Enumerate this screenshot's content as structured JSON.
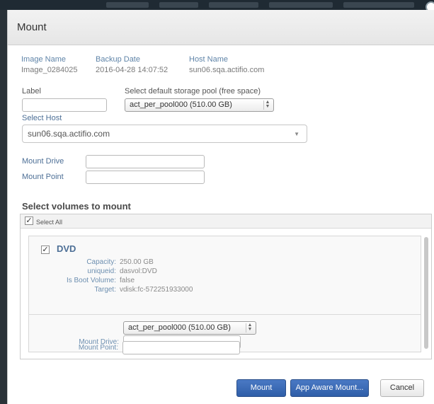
{
  "dialog": {
    "title": "Mount"
  },
  "image_info": {
    "image_name_label": "Image Name",
    "image_name_value": "Image_0284025",
    "backup_date_label": "Backup Date",
    "backup_date_value": "2016-04-28 14:07:52",
    "host_name_label": "Host Name",
    "host_name_value": "sun06.sqa.actifio.com"
  },
  "label_field": {
    "label": "Label",
    "value": ""
  },
  "storage_pool": {
    "label": "Select default storage pool (free space)",
    "value": "act_per_pool000 (510.00 GB)"
  },
  "host": {
    "label": "Select Host",
    "value": "sun06.sqa.actifio.com"
  },
  "mount_drive": {
    "label": "Mount Drive",
    "value": ""
  },
  "mount_point": {
    "label": "Mount Point",
    "value": ""
  },
  "volumes": {
    "title": "Select volumes to mount",
    "select_all_label": "Select All",
    "select_all_checked": true,
    "items": [
      {
        "name": "DVD",
        "checked": true,
        "capacity_label": "Capacity:",
        "capacity_value": "250.00 GB",
        "uniqueid_label": "uniqueid:",
        "uniqueid_value": "dasvol:DVD",
        "boot_label": "Is Boot Volume:",
        "boot_value": "false",
        "target_label": "Target:",
        "target_value": "vdisk:fc-572251933000",
        "pool_value": "act_per_pool000 (510.00 GB)",
        "mount_drive_label": "Mount Drive:",
        "mount_drive_value": "",
        "mount_point_label": "Mount Point:",
        "mount_point_value": ""
      }
    ]
  },
  "buttons": {
    "mount": "Mount",
    "app_aware": "App Aware Mount...",
    "cancel": "Cancel"
  },
  "colors": {
    "primary": "#3a69b5",
    "link_label": "#5f84a8"
  },
  "icons": {
    "checkbox_mark": "✓",
    "select_caret": "▼",
    "stepper": "⇕"
  }
}
